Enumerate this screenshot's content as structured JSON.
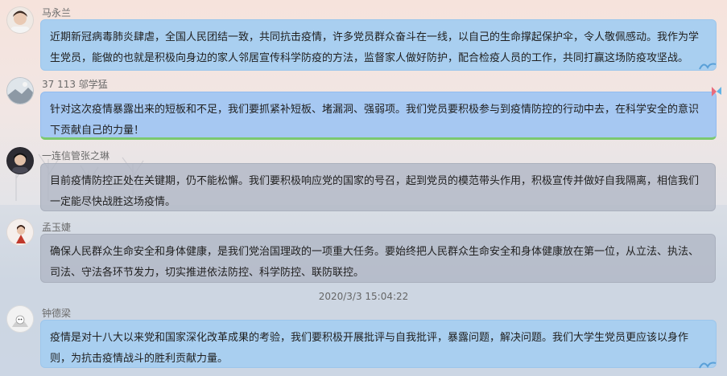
{
  "messages": [
    {
      "sender": "马永兰",
      "style": "blue",
      "text": "近期新冠病毒肺炎肆虐，全国人民团结一致，共同抗击疫情，许多党员群众奋斗在一线，以自己的生命撑起保护伞，令人敬佩感动。我作为学生党员，能做的也就是积极向身边的家人邻居宣传科学防疫的方法，监督家人做好防护，配合检疫人员的工作，共同打赢这场防疫攻坚战。"
    },
    {
      "sender": "37 113 邬学猛",
      "style": "blue2",
      "text": "针对这次疫情暴露出来的短板和不足，我们要抓紧补短板、堵漏洞、强弱项。我们党员要积极参与到疫情防控的行动中去，在科学安全的意识下贡献自己的力量！"
    },
    {
      "sender": "一连信管张之琳",
      "style": "grey",
      "text": "目前疫情防控正处在关键期，仍不能松懈。我们要积极响应党的国家的号召，起到党员的模范带头作用，积极宣传并做好自我隔离，相信我们一定能尽快战胜这场疫情。"
    },
    {
      "sender": "孟玉婕",
      "style": "grey",
      "text": "确保人民群众生命安全和身体健康，是我们党治国理政的一项重大任务。要始终把人民群众生命安全和身体健康放在第一位，从立法、执法、司法、守法各环节发力，切实推进依法防控、科学防控、联防联控。"
    },
    {
      "sender": "钟德梁",
      "style": "blue",
      "text": "疫情是对十八大以来党和国家深化改革成果的考验，我们要积极开展批评与自我批评，暴露问题，解决问题。我们大学生党员更应该以身作则，为抗击疫情战斗的胜利贡献力量。"
    }
  ],
  "timestamp": "2020/3/3 15:04:22"
}
